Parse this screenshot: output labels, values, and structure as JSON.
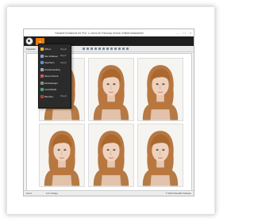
{
  "window": {
    "title": "Passbild Schablone Kit Prof. 1 Lizenz für Fotoshop Kenner Zeitbild Maskbeutel",
    "minimize": "–",
    "maximize": "□",
    "close": "×"
  },
  "ribbon": {
    "file_tab_glyph": "▾"
  },
  "toolbar": {
    "label": "Passbild"
  },
  "menu": {
    "items": [
      {
        "label": "Öffnen",
        "shortcut": "Strg+O",
        "icon": "open-folder-icon",
        "color": "#e8b33a"
      },
      {
        "label": "Neu Erfassen",
        "shortcut": "Strg+T",
        "icon": "new-document-icon",
        "color": "#6fa8dc"
      },
      {
        "label": "Speichern",
        "shortcut": "Strg+S",
        "icon": "save-icon",
        "color": "#5b8fd6"
      },
      {
        "label": "Druckeinstellungen",
        "shortcut": "",
        "icon": "print-settings-icon",
        "color": "#9aa6b2"
      },
      {
        "label": "Neue Kamera",
        "shortcut": "",
        "icon": "camera-icon",
        "color": "#d9534f"
      },
      {
        "label": "Einstellungen",
        "shortcut": "",
        "icon": "settings-icon",
        "color": "#8c8c8c"
      },
      {
        "label": "Ansichtsbild",
        "shortcut": "",
        "icon": "image-icon",
        "color": "#4aa36c"
      },
      {
        "label": "Beenden",
        "shortcut": "Strg+Q",
        "icon": "exit-icon",
        "color": "#c0392b"
      }
    ]
  },
  "photos": {
    "count": 6
  },
  "status": {
    "left": "Zoom",
    "mid": "1x1 Vorlage",
    "right": "© 2023 Passbild Software"
  }
}
